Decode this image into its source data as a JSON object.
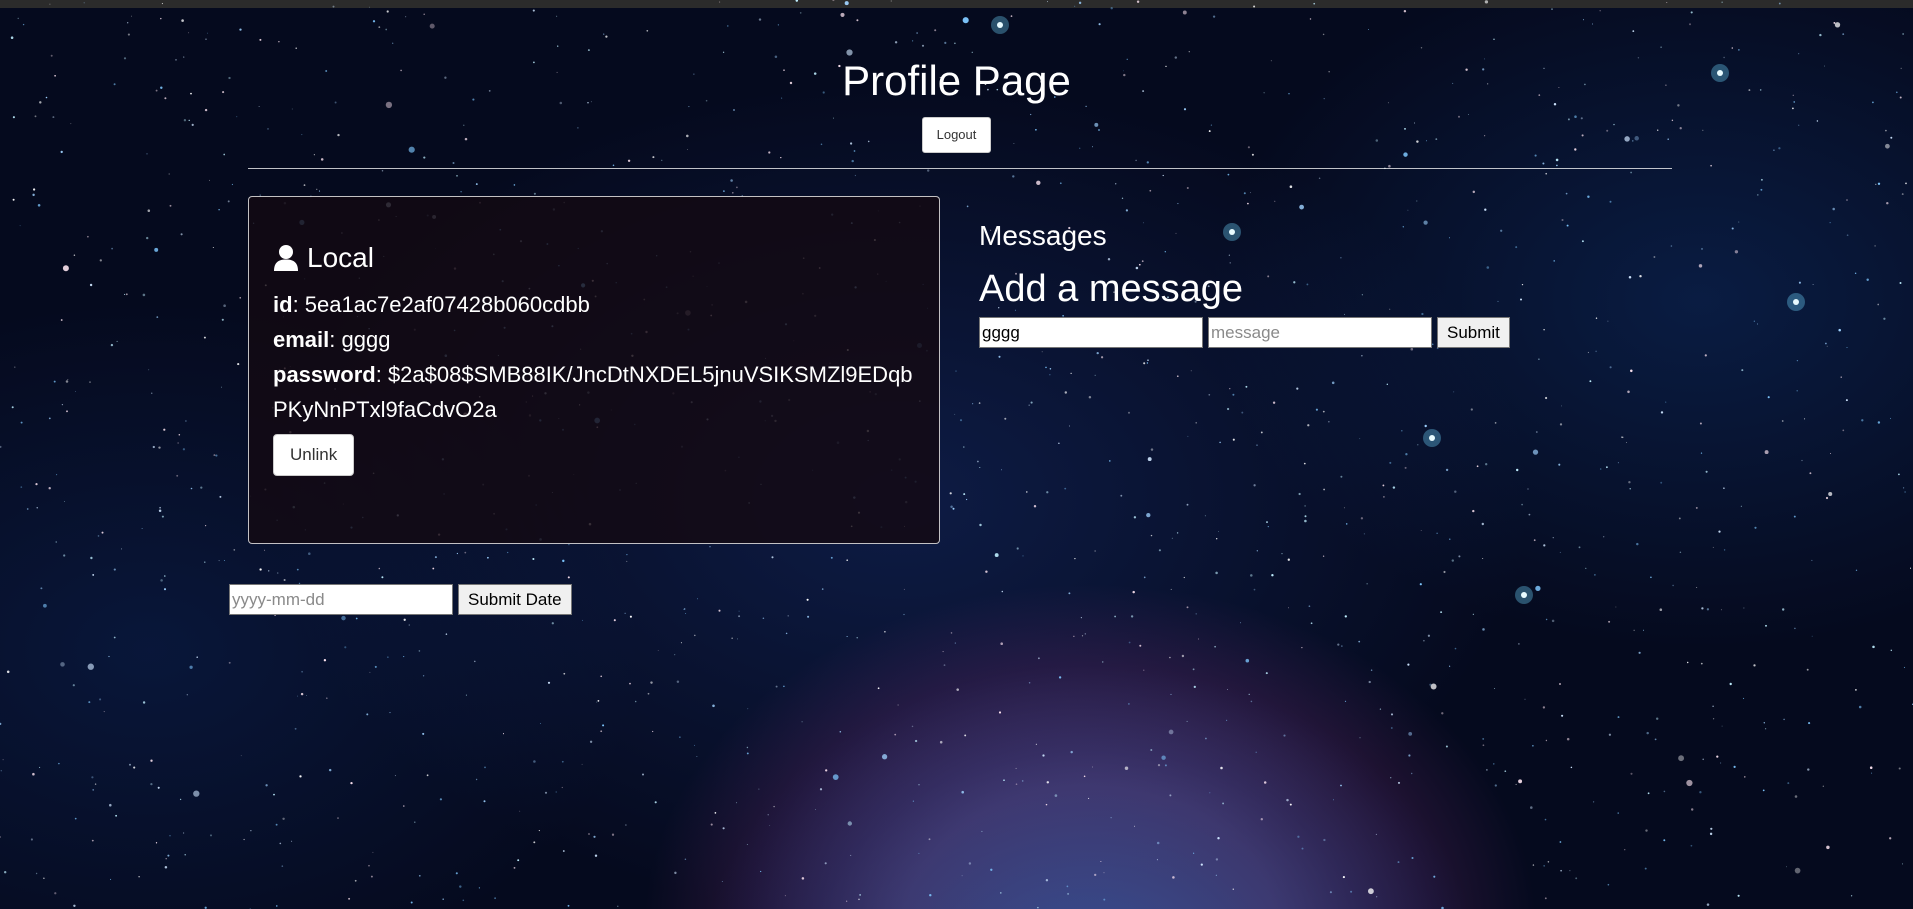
{
  "header": {
    "title": "Profile Page",
    "logout_label": "Logout"
  },
  "local_card": {
    "title": "Local",
    "icon": "user-icon",
    "id_label": "id",
    "id_value": "5ea1ac7e2af07428b060cdbb",
    "email_label": "email",
    "email_value": "gggg",
    "password_label": "password",
    "password_value": "$2a$08$SMB88IK/JncDtNXDEL5jnuVSIKSMZl9EDqbPKyNnPTxl9faCdvO2a",
    "unlink_label": "Unlink"
  },
  "messages": {
    "heading": "Messages",
    "add_heading": "Add a message",
    "name_value": "gggg",
    "message_placeholder": "message",
    "submit_label": "Submit"
  },
  "date_form": {
    "placeholder": "yyyy-mm-dd",
    "submit_label": "Submit Date"
  },
  "colors": {
    "background": "#050a1e",
    "card_background": "#140a12",
    "text": "#ffffff"
  }
}
